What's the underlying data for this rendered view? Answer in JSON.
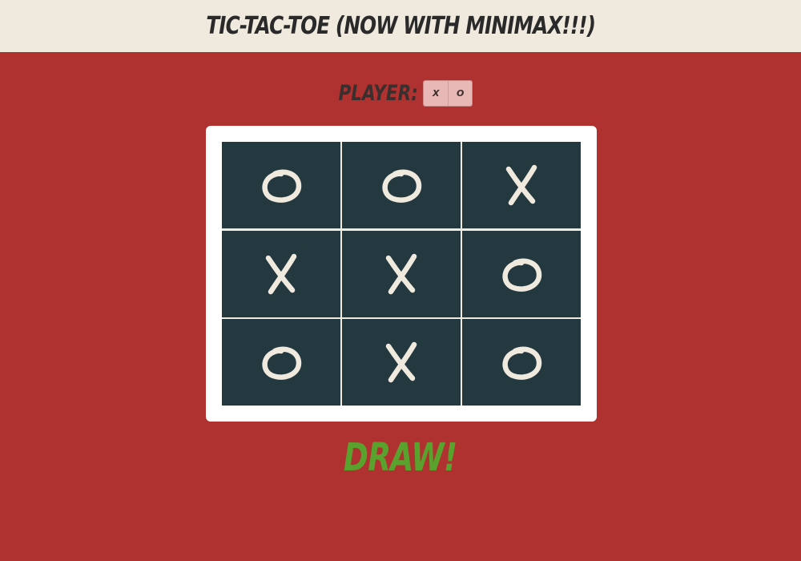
{
  "header": {
    "title": "Tic-Tac-Toe (now with Minimax!!!)"
  },
  "player": {
    "label": "Player:",
    "options": [
      "X",
      "O"
    ]
  },
  "board": {
    "cells": [
      "O",
      "O",
      "X",
      "X",
      "X",
      "O",
      "O",
      "X",
      "O"
    ]
  },
  "status": {
    "result": "Draw!"
  },
  "colors": {
    "background": "#b03230",
    "header_bg": "#efe9de",
    "cell_bg": "#243840",
    "mark": "#efe9de",
    "result": "#5aa22e"
  }
}
